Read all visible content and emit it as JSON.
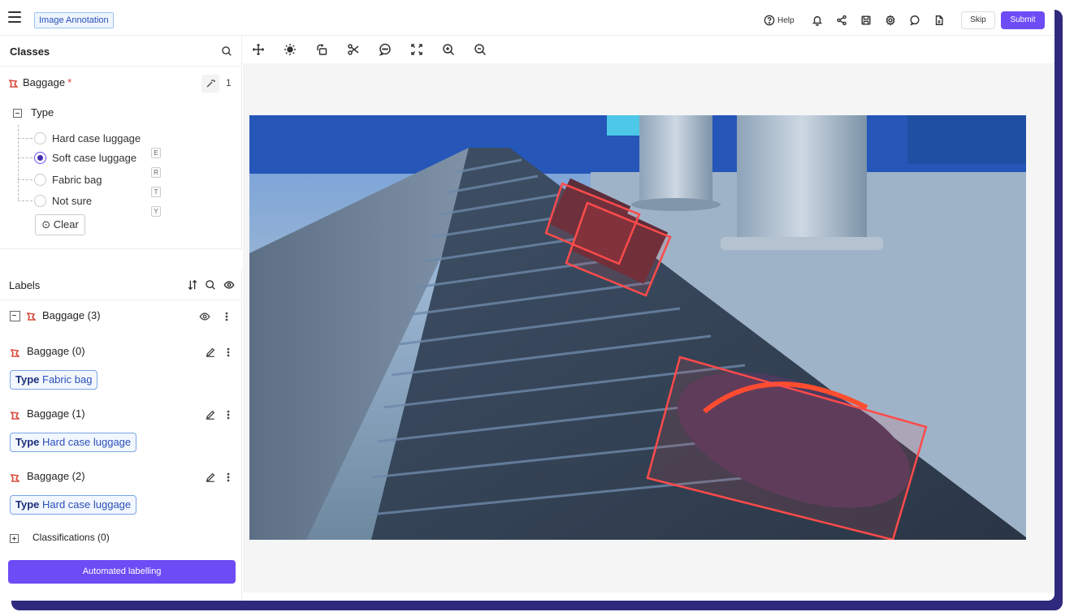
{
  "topbar": {
    "title": "Image Annotation",
    "help_label": "Help",
    "skip_label": "Skip",
    "submit_label": "Submit"
  },
  "classes": {
    "header": "Classes",
    "class_name": "Baggage",
    "required_mark": "*",
    "count": "1",
    "attribute_name": "Type",
    "options": [
      {
        "label": "Hard case luggage",
        "checked": false,
        "hotkey": ""
      },
      {
        "label": "Soft case luggage",
        "checked": true,
        "hotkey": "E"
      },
      {
        "label": "Fabric bag",
        "checked": false,
        "hotkey": "R"
      },
      {
        "label": "Not sure",
        "checked": false,
        "hotkey": "T"
      }
    ],
    "extra_hotkey": "Y",
    "clear_label": "Clear"
  },
  "labels": {
    "header": "Labels",
    "group_label": "Baggage (3)",
    "items": [
      {
        "name": "Baggage (0)",
        "attr": "Type",
        "value": "Fabric bag"
      },
      {
        "name": "Baggage (1)",
        "attr": "Type",
        "value": "Hard case luggage"
      },
      {
        "name": "Baggage (2)",
        "attr": "Type",
        "value": "Hard case luggage"
      }
    ],
    "classifications_label": "Classifications (0)"
  },
  "automated_label": "Automated labelling",
  "colors": {
    "accent": "#6d4cf5",
    "bbox": "#ff4b4b",
    "class_icon": "#d94a3c"
  },
  "toolbar_icons": [
    "move-icon",
    "brightness-icon",
    "rotate-icon",
    "scissors-icon",
    "comment-icon",
    "fit-screen-icon",
    "zoom-in-icon",
    "zoom-out-icon"
  ]
}
